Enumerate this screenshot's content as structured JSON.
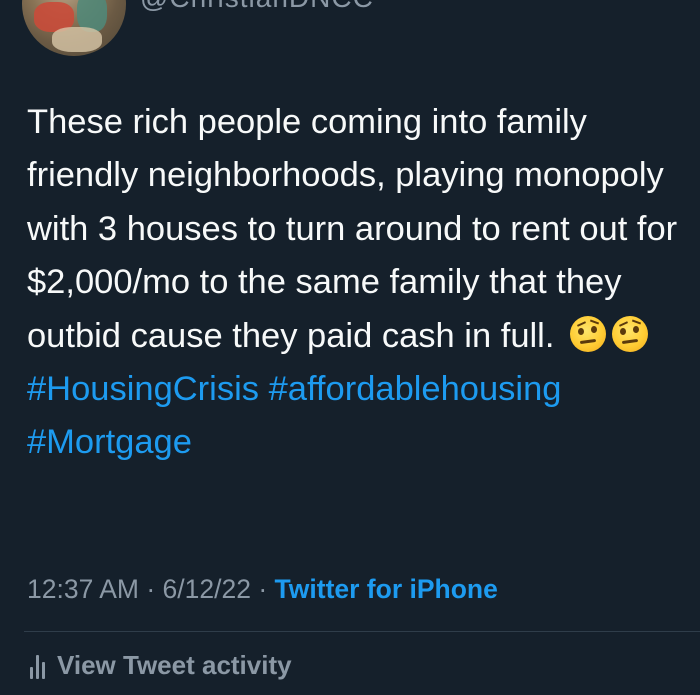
{
  "author": {
    "handle": "@ChristianDNCC"
  },
  "tweet": {
    "text": "These rich people coming into family friendly neighborhoods, playing monopoly with 3 houses to turn around to rent out for $2,000/mo to the same family that they outbid cause they paid cash in full.",
    "emojis": [
      "face-with-raised-eyebrow-emoji",
      "face-with-raised-eyebrow-emoji"
    ],
    "hashtags": [
      "#HousingCrisis",
      "#affordablehousing",
      "#Mortgage"
    ]
  },
  "meta": {
    "time": "12:37 AM",
    "separator": "·",
    "date": "6/12/22",
    "source": "Twitter for iPhone"
  },
  "activity": {
    "label": "View Tweet activity"
  },
  "colors": {
    "background": "#15202b",
    "text": "#f7f9f9",
    "secondary": "#8b98a5",
    "link": "#1d9bf0",
    "divider": "#2f3d4a"
  }
}
